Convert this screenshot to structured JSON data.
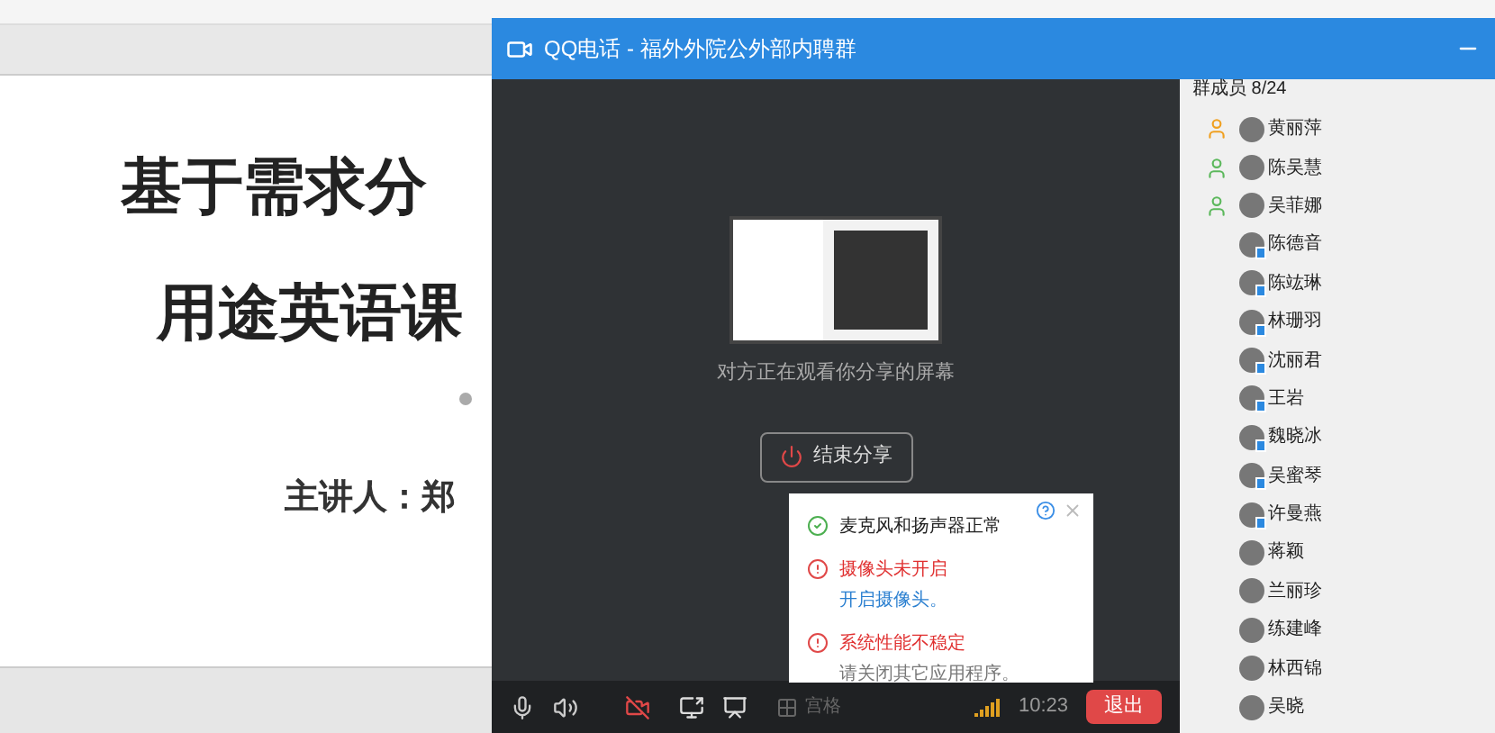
{
  "slide": {
    "title_lines": [
      "基于需求分",
      "用途英语课"
    ],
    "presenter": "主讲人：郑"
  },
  "window": {
    "title": "QQ电话 - 福外外院公外部内聘群"
  },
  "share": {
    "status": "对方正在观看你分享的屏幕",
    "stop_button": "结束分享"
  },
  "members": {
    "header": "群成员 8/24",
    "items": [
      {
        "name": "黄丽萍",
        "kind": "owner",
        "phone": false
      },
      {
        "name": "陈吴慧",
        "kind": "admin",
        "phone": false
      },
      {
        "name": "吴菲娜",
        "kind": "admin",
        "phone": false
      },
      {
        "name": "陈德音",
        "kind": "member",
        "phone": true
      },
      {
        "name": "陈竑琳",
        "kind": "member",
        "phone": true
      },
      {
        "name": "林珊羽",
        "kind": "member",
        "phone": true
      },
      {
        "name": "沈丽君",
        "kind": "member",
        "phone": true
      },
      {
        "name": "王岩",
        "kind": "member",
        "phone": true
      },
      {
        "name": "魏晓冰",
        "kind": "member",
        "phone": true
      },
      {
        "name": "吴蜜琴",
        "kind": "member",
        "phone": true
      },
      {
        "name": "许曼燕",
        "kind": "member",
        "phone": true
      },
      {
        "name": "蒋颖",
        "kind": "member",
        "phone": false
      },
      {
        "name": "兰丽珍",
        "kind": "member",
        "phone": false
      },
      {
        "name": "练建峰",
        "kind": "member",
        "phone": false
      },
      {
        "name": "林西锦",
        "kind": "member",
        "phone": false
      },
      {
        "name": "吴晓",
        "kind": "member",
        "phone": false
      }
    ]
  },
  "popup": {
    "items": [
      {
        "kind": "ok",
        "title": "麦克风和扬声器正常"
      },
      {
        "kind": "error",
        "title": "摄像头未开启",
        "link": "开启摄像头。"
      },
      {
        "kind": "error",
        "title": "系统性能不稳定",
        "hint": "请关闭其它应用程序。"
      }
    ]
  },
  "toolbar": {
    "camera_on": false,
    "grid_label": "宫格",
    "time": "10:23",
    "exit_button": "退出"
  }
}
